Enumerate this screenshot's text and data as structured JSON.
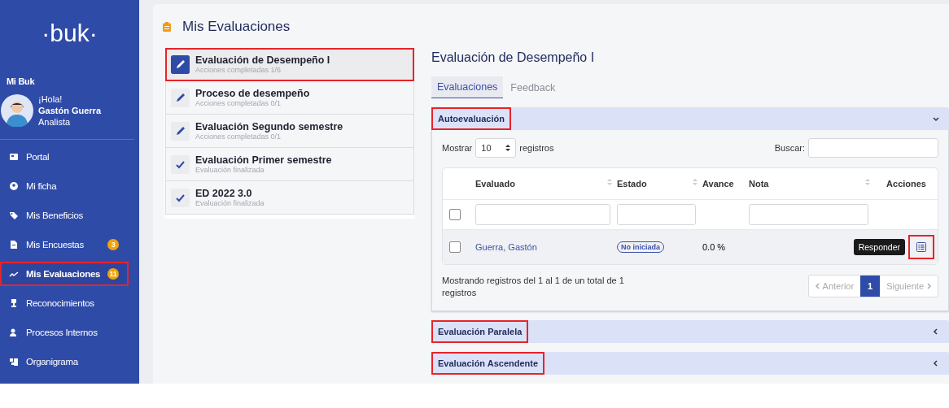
{
  "sidebar": {
    "logo": "·buk·",
    "section_label": "Mi Buk",
    "user": {
      "greeting": "¡Hola!",
      "name": "Gastón Guerra",
      "role": "Analista"
    },
    "items": [
      {
        "label": "Portal",
        "selected": false,
        "highlighted": false
      },
      {
        "label": "Mi ficha",
        "selected": false,
        "highlighted": false
      },
      {
        "label": "Mis Beneficios",
        "selected": false,
        "highlighted": false
      },
      {
        "label": "Mis Encuestas",
        "badge": "3",
        "selected": false,
        "highlighted": false
      },
      {
        "label": "Mis Evaluaciones",
        "badge": "11",
        "selected": true,
        "highlighted": true
      },
      {
        "label": "Reconocimientos",
        "selected": false,
        "highlighted": false
      },
      {
        "label": "Procesos Internos",
        "selected": false,
        "highlighted": false
      },
      {
        "label": "Organigrama",
        "selected": false,
        "highlighted": false
      }
    ]
  },
  "page_title": "Mis Evaluaciones",
  "evaluations": [
    {
      "title": "Evaluación de Desempeño I",
      "subtitle": "Acciones completadas 1/6",
      "kind": "pending",
      "selected": true,
      "highlighted": true
    },
    {
      "title": "Proceso de desempeño",
      "subtitle": "Acciones completadas 0/1",
      "kind": "pending",
      "selected": false,
      "highlighted": false
    },
    {
      "title": "Evaluación Segundo semestre",
      "subtitle": "Acciones completadas 0/1",
      "kind": "pending",
      "selected": false,
      "highlighted": false
    },
    {
      "title": "Evaluación Primer semestre",
      "subtitle": "Evaluación finalizada",
      "kind": "done",
      "selected": false,
      "highlighted": false
    },
    {
      "title": "ED 2022 3.0",
      "subtitle": "Evaluación finalizada",
      "kind": "done",
      "selected": false,
      "highlighted": false
    }
  ],
  "detail": {
    "title": "Evaluación de Desempeño I",
    "tabs": [
      {
        "label": "Evaluaciones",
        "selected": true
      },
      {
        "label": "Feedback",
        "selected": false
      }
    ],
    "sections": [
      {
        "title": "Autoevaluación",
        "expanded": true,
        "highlighted": true
      },
      {
        "title": "Evaluación Paralela",
        "expanded": false,
        "highlighted": true
      },
      {
        "title": "Evaluación Ascendente",
        "expanded": false,
        "highlighted": true
      }
    ],
    "table": {
      "show_label": "Mostrar",
      "page_size": "10",
      "records_label": "registros",
      "search_label": "Buscar:",
      "filter_checked": false,
      "columns": [
        {
          "label": "Evaluado",
          "sortable": true
        },
        {
          "label": "Estado",
          "sortable": true
        },
        {
          "label": "Avance",
          "sortable": false
        },
        {
          "label": "Nota",
          "sortable": true
        },
        {
          "label": "Acciones",
          "sortable": false
        }
      ],
      "rows": [
        {
          "checked": false,
          "evaluado": "Guerra, Gastón",
          "estado": "No iniciada",
          "avance": "0.0 %",
          "action_tooltip": "Responder",
          "action_highlighted": true
        }
      ],
      "info": "Mostrando registros del 1 al 1 de un total de 1 registros",
      "pagination": {
        "previous": "Anterior",
        "pages": [
          {
            "label": "1",
            "selected": true
          }
        ],
        "next": "Siguiente"
      }
    }
  }
}
